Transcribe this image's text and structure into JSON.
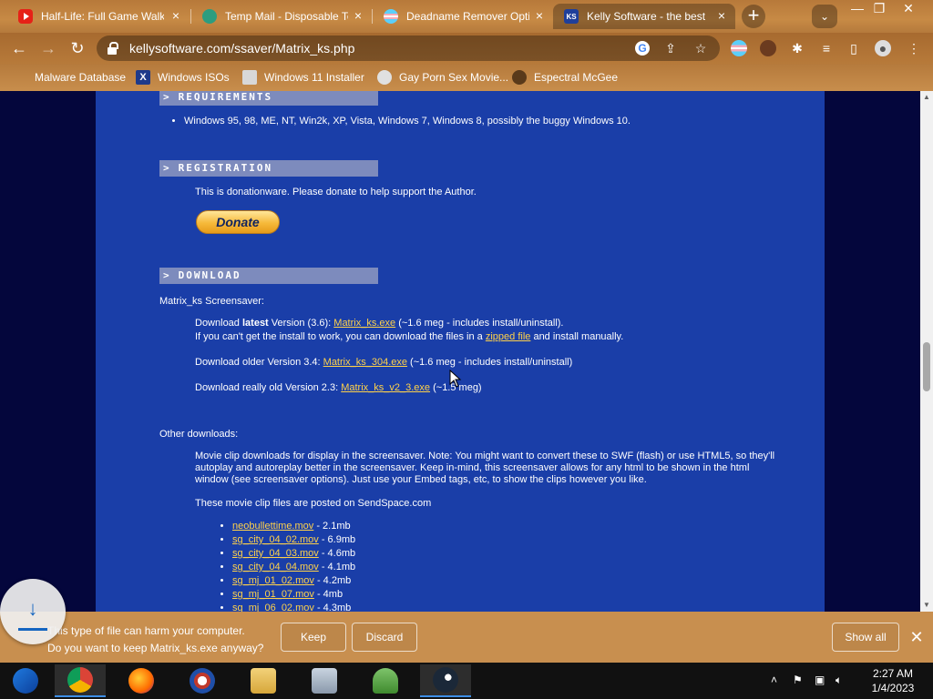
{
  "tabs": [
    {
      "title": "Half-Life: Full Game Walk",
      "icon": "youtube-icon"
    },
    {
      "title": "Temp Mail - Disposable Te",
      "icon": "temp-mail-icon"
    },
    {
      "title": "Deadname Remover Optio",
      "icon": "trans-flag-icon"
    },
    {
      "title": "Kelly Software - the best",
      "icon": "kelly-software-icon"
    }
  ],
  "window_controls": {
    "minimize": "—",
    "restore": "❐",
    "close": "✕"
  },
  "address_bar": {
    "url": "kellysoftware.com/ssaver/Matrix_ks.php"
  },
  "bookmarks": [
    {
      "label": "Malware Database"
    },
    {
      "label": "Windows ISOs"
    },
    {
      "label": "Windows 11 Installer"
    },
    {
      "label": "Gay Porn Sex Movie..."
    },
    {
      "label": "Espectral McGee"
    }
  ],
  "page": {
    "requirements": {
      "heading": "REQUIREMENTS",
      "item": "Windows 95, 98, ME, NT, Win2k, XP, Vista, Windows 7, Windows 8, possibly the buggy Windows 10."
    },
    "registration": {
      "heading": "REGISTRATION",
      "text": "This is donationware. Please donate to help support the Author.",
      "donate_label": "Donate"
    },
    "download": {
      "heading": "DOWNLOAD",
      "product_label": "Matrix_ks Screensaver:",
      "latest_prefix": "Download ",
      "latest_bold": "latest",
      "latest_version": " Version (3.6): ",
      "latest_link": "Matrix_ks.exe",
      "latest_suffix": " (~1.6 meg - includes install/uninstall).",
      "zip_prefix": "If you can't get the install to work, you can download the files in a ",
      "zip_link": "zipped file",
      "zip_suffix": " and install manually.",
      "older_prefix": "Download older Version 3.4: ",
      "older_link": "Matrix_ks_304.exe",
      "older_suffix": " (~1.6 meg - includes install/uninstall)",
      "old_prefix": "Download really old Version 2.3: ",
      "old_link": "Matrix_ks_v2_3.exe",
      "old_suffix": " (~1.5 meg)"
    },
    "other_downloads": {
      "heading": "Other downloads:",
      "description": "Movie clip downloads for display in the screensaver. Note: You might want to convert these to SWF (flash) or use HTML5, so they'll autoplay and autoreplay better in the screensaver. Keep in-mind, this screensaver allows for any html to be shown in the html window (see screensaver options). Just use your Embed tags, etc, to show the clips however you like.",
      "posted": "These movie clip files are posted on SendSpace.com",
      "files": [
        {
          "name": "neobullettime.mov",
          "size": " - 2.1mb"
        },
        {
          "name": "sg_city_04_02.mov",
          "size": " - 6.9mb"
        },
        {
          "name": "sg_city_04_03.mov",
          "size": " - 4.6mb"
        },
        {
          "name": "sg_city_04_04.mov",
          "size": " - 4.1mb"
        },
        {
          "name": "sg_mj_01_02.mov",
          "size": " - 4.2mb"
        },
        {
          "name": "sg_mj_01_07.mov",
          "size": " - 4mb"
        },
        {
          "name": "sg_mj_06_02.mov",
          "size": " - 4.3mb"
        }
      ]
    }
  },
  "download_bar": {
    "line1": "This type of file can harm your computer.",
    "line2": "Do you want to keep Matrix_ks.exe anyway?",
    "keep_label": "Keep",
    "discard_label": "Discard",
    "show_all_label": "Show all"
  },
  "taskbar": {
    "apps": [
      "start-icon",
      "chrome-icon",
      "firefox-icon",
      "obama-icon",
      "file-explorer-icon",
      "control-panel-icon",
      "network-icon",
      "steam-icon"
    ],
    "time": "2:27 AM",
    "date": "1/4/2023"
  },
  "colors": {
    "page_bg": "#04063c",
    "content_bg": "#1a3ea8",
    "link": "#ffd24a",
    "section_bar": "#7d8bbd",
    "chrome_theme": "#b7793a"
  }
}
